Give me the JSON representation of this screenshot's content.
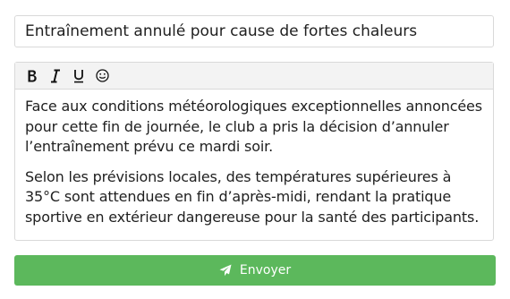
{
  "subject": {
    "value": "Entraînement annulé pour cause de fortes chaleurs"
  },
  "toolbar": {
    "buttons": [
      {
        "icon": "bold-icon"
      },
      {
        "icon": "italic-icon"
      },
      {
        "icon": "underline-icon"
      },
      {
        "icon": "emoji-icon"
      }
    ]
  },
  "message": {
    "paragraphs": [
      "Face aux conditions météorologiques exceptionnelles annoncées pour cette fin de journée, le club a pris la décision d’annuler l’entraînement prévu ce mardi soir.",
      "Selon les prévisions locales, des températures supérieures à 35°C sont attendues en fin d’après-midi, rendant la pratique sportive en extérieur dangereuse pour la santé des participants."
    ]
  },
  "send_button": {
    "label": "Envoyer",
    "icon": "paper-plane-icon",
    "color": "#5cb85c"
  }
}
